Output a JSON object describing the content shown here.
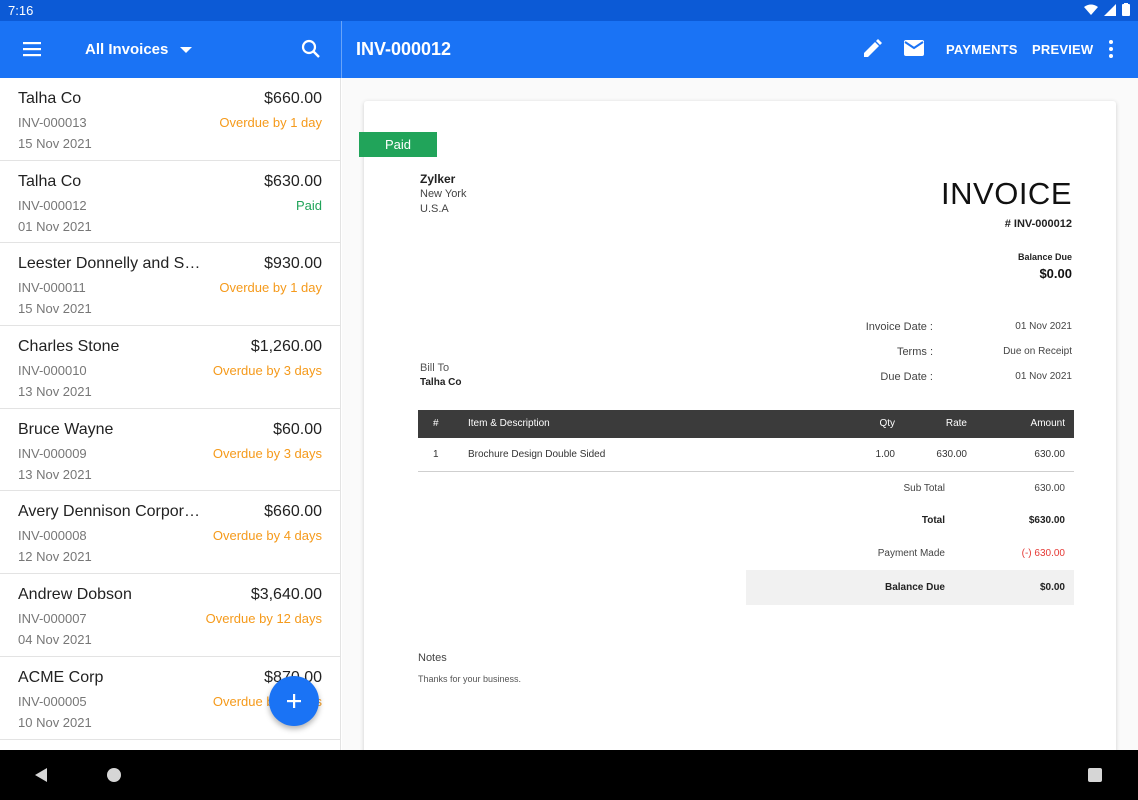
{
  "status_bar": {
    "time": "7:16"
  },
  "app_bar": {
    "filter_label": "All Invoices",
    "invoice_title": "INV-000012",
    "payments_label": "PAYMENTS",
    "preview_label": "PREVIEW"
  },
  "colors": {
    "primary": "#1a73f5",
    "overdue": "#f59a1b",
    "paid": "#21a45a",
    "payment_made": "#e53935"
  },
  "invoices": [
    {
      "customer": "Talha Co",
      "amount": "$660.00",
      "number": "INV-000013",
      "status": "Overdue by 1 day",
      "status_type": "overdue",
      "date": "15 Nov 2021"
    },
    {
      "customer": "Talha Co",
      "amount": "$630.00",
      "number": "INV-000012",
      "status": "Paid",
      "status_type": "paid",
      "date": "01 Nov 2021"
    },
    {
      "customer": "Leester Donnelly and So…",
      "amount": "$930.00",
      "number": "INV-000011",
      "status": "Overdue by 1 day",
      "status_type": "overdue",
      "date": "15 Nov 2021"
    },
    {
      "customer": "Charles Stone",
      "amount": "$1,260.00",
      "number": "INV-000010",
      "status": "Overdue by 3 days",
      "status_type": "overdue",
      "date": "13 Nov 2021"
    },
    {
      "customer": "Bruce Wayne",
      "amount": "$60.00",
      "number": "INV-000009",
      "status": "Overdue by 3 days",
      "status_type": "overdue",
      "date": "13 Nov 2021"
    },
    {
      "customer": "Avery Dennison Corpora…",
      "amount": "$660.00",
      "number": "INV-000008",
      "status": "Overdue by 4 days",
      "status_type": "overdue",
      "date": "12 Nov 2021"
    },
    {
      "customer": "Andrew Dobson",
      "amount": "$3,640.00",
      "number": "INV-000007",
      "status": "Overdue by 12 days",
      "status_type": "overdue",
      "date": "04 Nov 2021"
    },
    {
      "customer": "ACME Corp",
      "amount": "$870.00",
      "number": "INV-000005",
      "status": "Overdue by 5 days",
      "status_type": "overdue",
      "date": "10 Nov 2021"
    }
  ],
  "invoice_doc": {
    "ribbon": "Paid",
    "company": "Zylker",
    "company_line2": "New York",
    "company_line3": "U.S.A",
    "heading": "INVOICE",
    "number": "# INV-000012",
    "balance_due_label": "Balance Due",
    "balance_due_value": "$0.00",
    "invoice_date_label": "Invoice Date :",
    "invoice_date_value": "01 Nov 2021",
    "terms_label": "Terms :",
    "terms_value": "Due on Receipt",
    "due_date_label": "Due Date :",
    "due_date_value": "01 Nov 2021",
    "bill_to_label": "Bill To",
    "bill_to_name": "Talha Co",
    "table_headers": {
      "index": "#",
      "item": "Item & Description",
      "qty": "Qty",
      "rate": "Rate",
      "amount": "Amount"
    },
    "line_items": [
      {
        "index": "1",
        "item": "Brochure Design Double Sided",
        "qty": "1.00",
        "rate": "630.00",
        "amount": "630.00"
      }
    ],
    "sub_total_label": "Sub Total",
    "sub_total_value": "630.00",
    "total_label": "Total",
    "total_value": "$630.00",
    "payment_made_label": "Payment Made",
    "payment_made_value": "(-) 630.00",
    "final_balance_label": "Balance Due",
    "final_balance_value": "$0.00",
    "notes_label": "Notes",
    "notes_text": "Thanks for your business."
  }
}
